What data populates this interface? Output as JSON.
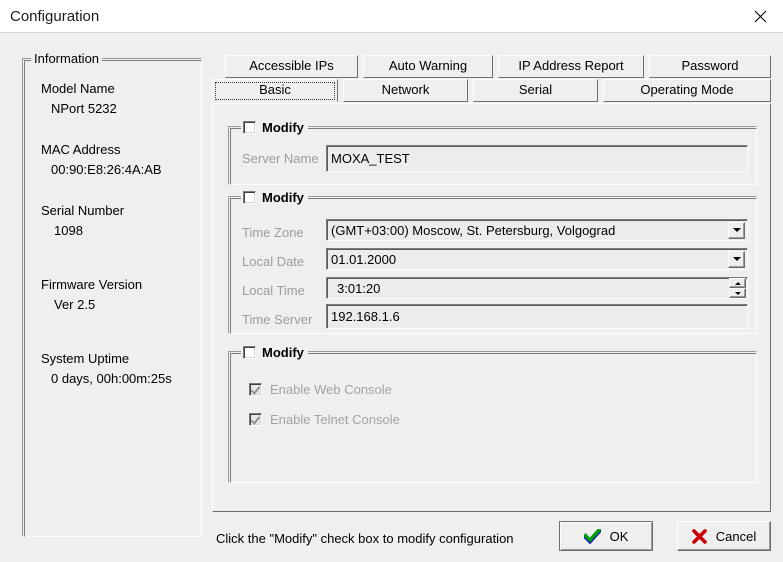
{
  "window": {
    "title": "Configuration",
    "close_icon": "close-icon"
  },
  "information": {
    "legend": "Information",
    "rows": [
      {
        "label": "Model Name",
        "value": "NPort 5232"
      },
      {
        "label": "MAC Address",
        "value": "00:90:E8:26:4A:AB"
      },
      {
        "label": "Serial Number",
        "value": "1098"
      },
      {
        "label": "Firmware Version",
        "value": "Ver 2.5"
      },
      {
        "label": "System Uptime",
        "value": "0 days, 00h:00m:25s"
      }
    ]
  },
  "tabs": {
    "row1": [
      {
        "label": "Accessible IPs",
        "selected": false
      },
      {
        "label": "Auto Warning",
        "selected": false
      },
      {
        "label": "IP Address Report",
        "selected": false
      },
      {
        "label": "Password",
        "selected": false
      }
    ],
    "row2": [
      {
        "label": "Basic",
        "selected": true
      },
      {
        "label": "Network",
        "selected": false
      },
      {
        "label": "Serial",
        "selected": false
      },
      {
        "label": "Operating Mode",
        "selected": false
      }
    ]
  },
  "basic": {
    "server_group": {
      "modify_label": "Modify",
      "modify_checked": false,
      "server_name_label": "Server Name",
      "server_name_value": "MOXA_TEST"
    },
    "time_group": {
      "modify_label": "Modify",
      "modify_checked": false,
      "time_zone_label": "Time Zone",
      "time_zone_value": "(GMT+03:00) Moscow, St. Petersburg, Volgograd",
      "local_date_label": "Local Date",
      "local_date_value": "01.01.2000",
      "local_time_label": "Local Time",
      "local_time_value": "3:01:20",
      "time_server_label": "Time Server",
      "time_server_value": "192.168.1.6"
    },
    "console_group": {
      "modify_label": "Modify",
      "modify_checked": false,
      "web_console_label": "Enable Web Console",
      "web_console_checked": true,
      "telnet_console_label": "Enable Telnet Console",
      "telnet_console_checked": true
    }
  },
  "footer": {
    "hint": "Click the \"Modify\" check box to modify configuration",
    "ok_label": "OK",
    "cancel_label": "Cancel",
    "ok_icon": "check-icon",
    "cancel_icon": "x-icon"
  },
  "colors": {
    "face": "#efefef",
    "titlebar": "#ffffff",
    "disabled_text": "#9c9c9c",
    "ok_check": "#00a000",
    "cancel_x": "#cc0000"
  }
}
